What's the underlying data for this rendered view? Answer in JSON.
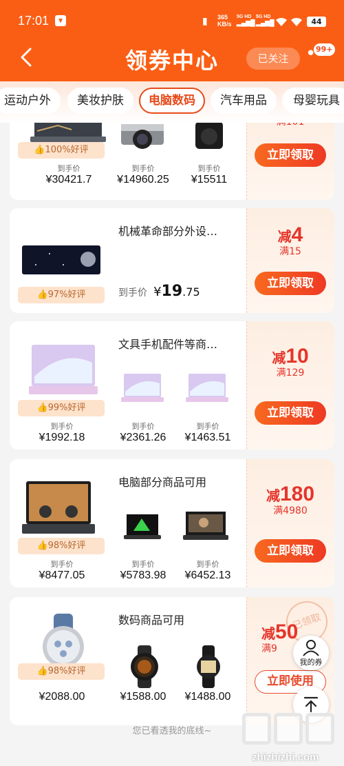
{
  "status_bar": {
    "time": "17:01",
    "net_speed_top": "365",
    "net_speed_unit": "KB/s",
    "sim1": "5G HD",
    "sim2": "5G HD",
    "battery": "44"
  },
  "header": {
    "title": "领券中心",
    "follow_label": "已关注",
    "badge_count": "99+"
  },
  "tabs": [
    {
      "label": "运动户外",
      "active": false
    },
    {
      "label": "美妆护肤",
      "active": false
    },
    {
      "label": "电脑数码",
      "active": true
    },
    {
      "label": "汽车用品",
      "active": false
    },
    {
      "label": "母婴玩具",
      "active": false
    }
  ],
  "price_prefix": "到手价",
  "cards": [
    {
      "title": "",
      "rating": "100%好评",
      "products": [
        {
          "price": "¥30421.7"
        },
        {
          "price": "¥14960.25"
        },
        {
          "price": "¥15511"
        }
      ],
      "discount_prefix": "",
      "discount_amount": "",
      "min_spend": "满101",
      "button": "立即领取"
    },
    {
      "title": "机械革命部分外设…",
      "rating": "97%好评",
      "single_price_label": "到手价",
      "single_price_symbol": "¥",
      "single_price_int": "19",
      "single_price_dec": ".75",
      "discount_prefix": "减",
      "discount_amount": "4",
      "min_spend": "满15",
      "button": "立即领取"
    },
    {
      "title": "文具手机配件等商…",
      "rating": "99%好评",
      "products": [
        {
          "price": "¥1992.18"
        },
        {
          "price": "¥2361.26"
        },
        {
          "price": "¥1463.51"
        }
      ],
      "discount_prefix": "减",
      "discount_amount": "10",
      "min_spend": "满129",
      "button": "立即领取"
    },
    {
      "title": "电脑部分商品可用",
      "rating": "98%好评",
      "products": [
        {
          "price": "¥8477.05"
        },
        {
          "price": "¥5783.98"
        },
        {
          "price": "¥6452.13"
        }
      ],
      "discount_prefix": "减",
      "discount_amount": "180",
      "min_spend": "满4980",
      "button": "立即领取"
    },
    {
      "title": "数码商品可用",
      "rating": "98%好评",
      "products": [
        {
          "price": "¥2088.00"
        },
        {
          "price": "¥1588.00"
        },
        {
          "price": "¥1488.00"
        }
      ],
      "discount_prefix": "减",
      "discount_amount": "50",
      "min_spend": "满9",
      "button": "立即使用",
      "stamp": "已领取"
    }
  ],
  "my_coupons_label": "我的券",
  "footer_text": "您已看透我的底线~",
  "watermark": "zhizhizhi.com",
  "colors": {
    "brand": "#fa5e14",
    "accent_red": "#e5352b",
    "rating_bg": "#fde2cc"
  }
}
